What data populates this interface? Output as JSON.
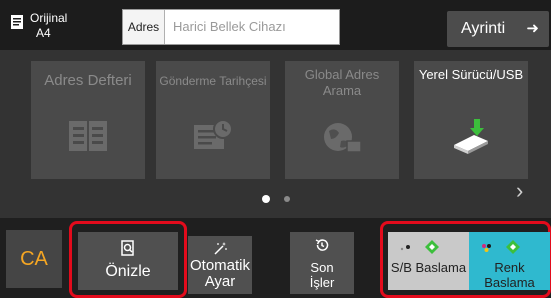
{
  "header": {
    "original_label": "Orijinal",
    "original_size": "A4",
    "address_label": "Adres",
    "address_placeholder": "Harici Bellek Cihazı",
    "detail_button": "Ayrinti"
  },
  "tiles": [
    {
      "label": "Adres Defteri",
      "icon": "address-book-icon",
      "active": false
    },
    {
      "label": "Gönderme Tarihçesi",
      "icon": "send-history-icon",
      "active": false
    },
    {
      "label": "Global Adres Arama",
      "icon": "global-search-icon",
      "active": false
    },
    {
      "label": "Yerel Sürücü/USB",
      "icon": "usb-drive-icon",
      "active": true
    }
  ],
  "pager": {
    "current": 1,
    "total": 2
  },
  "bottom": {
    "ca_label": "CA",
    "preview_label": "Önizle",
    "auto_label": "Otomatik Ayar",
    "recent_label": "Son İşler",
    "bw_start": "S/B Baslama",
    "color_start": "Renk Baslama"
  },
  "colors": {
    "highlight": "#e30b1c",
    "ca_text": "#f5a623",
    "start_gray": "#c9c9c9",
    "start_cyan": "#2fb9cf",
    "diamond_green": "#3cbf3c"
  }
}
